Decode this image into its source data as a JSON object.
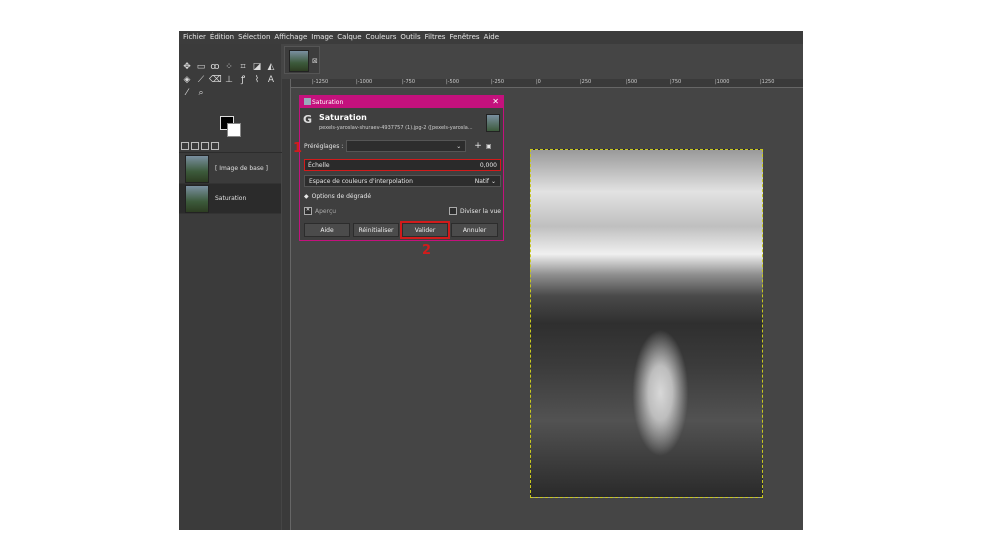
{
  "menu": [
    "Fichier",
    "Édition",
    "Sélection",
    "Affichage",
    "Image",
    "Calque",
    "Couleurs",
    "Outils",
    "Filtres",
    "Fenêtres",
    "Aide"
  ],
  "ruler_ticks": [
    "|-1250",
    "|-1000",
    "|-750",
    "|-500",
    "|-250",
    "|0",
    "|250",
    "|500",
    "|750",
    "|1000",
    "|1250"
  ],
  "layers": [
    {
      "name": "[ Image de base ]"
    },
    {
      "name": "Saturation"
    }
  ],
  "dialog": {
    "title": "Saturation",
    "name": "Saturation",
    "subtitle": "pexels-yaroslav-shuraev-4937757 (1).jpg-2 ([pexels-yarosla...",
    "presets_label": "Préréglages :",
    "scale_label": "Échelle",
    "scale_value": "0,000",
    "interp_label": "Espace de couleurs d'interpolation",
    "interp_value": "Natif",
    "gradient_options": "Options de dégradé",
    "preview": "Aperçu",
    "split_view": "Diviser la vue",
    "btn_help": "Aide",
    "btn_reset": "Réinitialiser",
    "btn_ok": "Valider",
    "btn_cancel": "Annuler"
  },
  "annotations": {
    "one": "1",
    "two": "2"
  },
  "colors": {
    "accent": "#c4117d",
    "highlight": "#d21b1b"
  }
}
